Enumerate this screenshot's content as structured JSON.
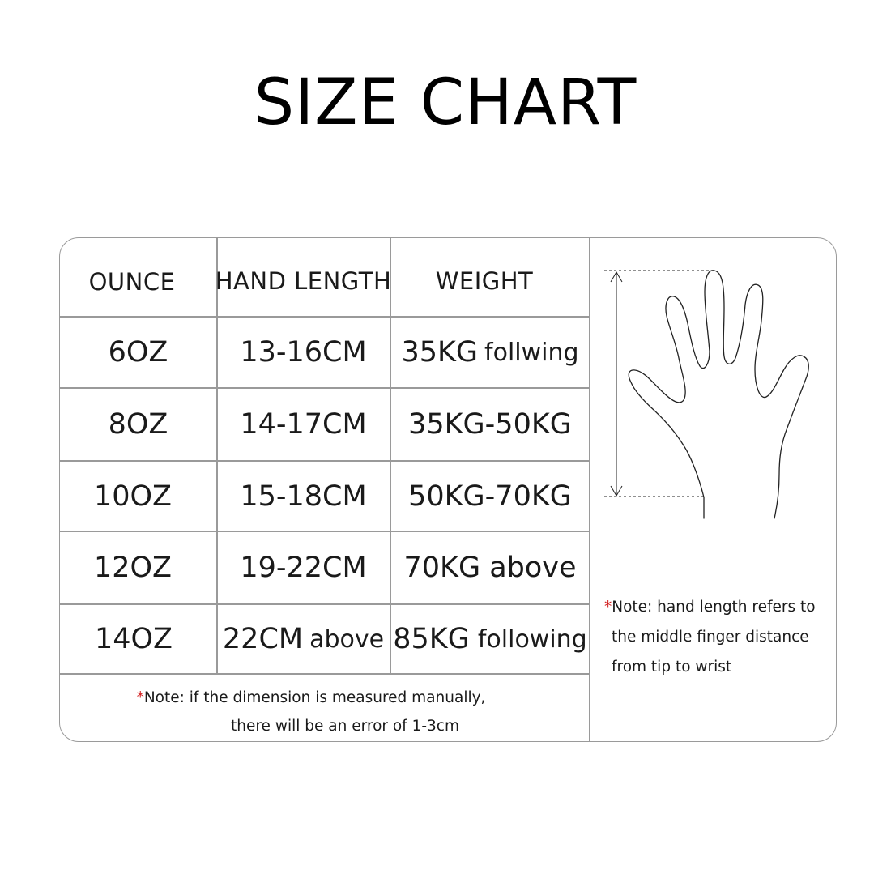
{
  "title": "SIZE CHART",
  "table": {
    "headers": [
      "OUNCE",
      "HAND LENGTH",
      "WEIGHT"
    ],
    "rows": [
      {
        "ounce": "6OZ",
        "hand_length": "13-16CM",
        "weight_main": "35KG",
        "weight_suffix": "follwing"
      },
      {
        "ounce": "8OZ",
        "hand_length": "14-17CM",
        "weight_main": "35KG-50KG",
        "weight_suffix": ""
      },
      {
        "ounce": "10OZ",
        "hand_length": "15-18CM",
        "weight_main": "50KG-70KG",
        "weight_suffix": ""
      },
      {
        "ounce": "12OZ",
        "hand_length": "19-22CM",
        "weight_main": "70KG above",
        "weight_suffix": ""
      },
      {
        "ounce": "14OZ",
        "hand_length_main": "22CM",
        "hand_length_suffix": "above",
        "weight_main": "85KG",
        "weight_suffix": "following"
      }
    ]
  },
  "footnote": {
    "star": "*",
    "line1": "Note: if the dimension is measured manually,",
    "line2": "there will be an error of 1-3cm"
  },
  "side_note": {
    "star": "*",
    "line1": "Note: hand length refers to",
    "line2": "the middle finger distance",
    "line3": "from tip to wrist"
  },
  "colors": {
    "border": "#9a9a9a",
    "text": "#1a1a1a",
    "star": "#d22020"
  },
  "illustration": "hand-outline-icon"
}
